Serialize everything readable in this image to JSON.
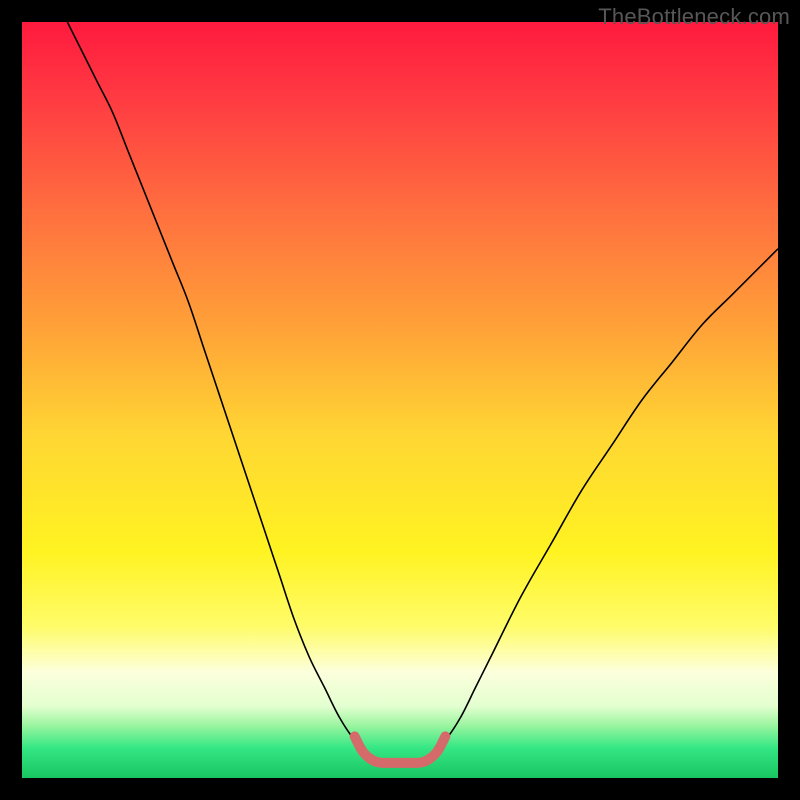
{
  "watermark": "TheBottleneck.com",
  "chart_data": {
    "type": "line",
    "title": "",
    "xlabel": "",
    "ylabel": "",
    "xlim": [
      0,
      100
    ],
    "ylim": [
      0,
      100
    ],
    "background_gradient": [
      {
        "stop": 0.0,
        "color": "#ff1a3e"
      },
      {
        "stop": 0.1,
        "color": "#ff3a42"
      },
      {
        "stop": 0.25,
        "color": "#ff6f3f"
      },
      {
        "stop": 0.4,
        "color": "#ffa038"
      },
      {
        "stop": 0.55,
        "color": "#ffd733"
      },
      {
        "stop": 0.7,
        "color": "#fff321"
      },
      {
        "stop": 0.8,
        "color": "#fffc6a"
      },
      {
        "stop": 0.86,
        "color": "#fcffdc"
      },
      {
        "stop": 0.905,
        "color": "#e3ffd0"
      },
      {
        "stop": 0.93,
        "color": "#9cf5a0"
      },
      {
        "stop": 0.96,
        "color": "#35e784"
      },
      {
        "stop": 1.0,
        "color": "#18c561"
      }
    ],
    "series": [
      {
        "name": "bottleneck-curve",
        "color": "#000000",
        "width": 1.6,
        "x": [
          6,
          8,
          10,
          12,
          14,
          16,
          18,
          20,
          22,
          24,
          26,
          28,
          30,
          32,
          34,
          36,
          38,
          40,
          42,
          44,
          46,
          48,
          50,
          52,
          54,
          56,
          58,
          60,
          62,
          66,
          70,
          74,
          78,
          82,
          86,
          90,
          94,
          98,
          100
        ],
        "y": [
          100,
          96,
          92,
          88,
          83,
          78,
          73,
          68,
          63,
          57,
          51,
          45,
          39,
          33,
          27,
          21,
          16,
          12,
          8,
          5,
          3,
          2,
          2,
          2,
          3,
          5,
          8,
          12,
          16,
          24,
          31,
          38,
          44,
          50,
          55,
          60,
          64,
          68,
          70
        ]
      },
      {
        "name": "optimal-zone",
        "color": "#d46a6a",
        "width": 10,
        "linecap": "round",
        "x": [
          44,
          45,
          46,
          47,
          48,
          49,
          50,
          51,
          52,
          53,
          54,
          55,
          56
        ],
        "y": [
          5.5,
          3.6,
          2.6,
          2.1,
          2.0,
          2.0,
          2.0,
          2.0,
          2.0,
          2.1,
          2.6,
          3.6,
          5.5
        ]
      }
    ]
  }
}
